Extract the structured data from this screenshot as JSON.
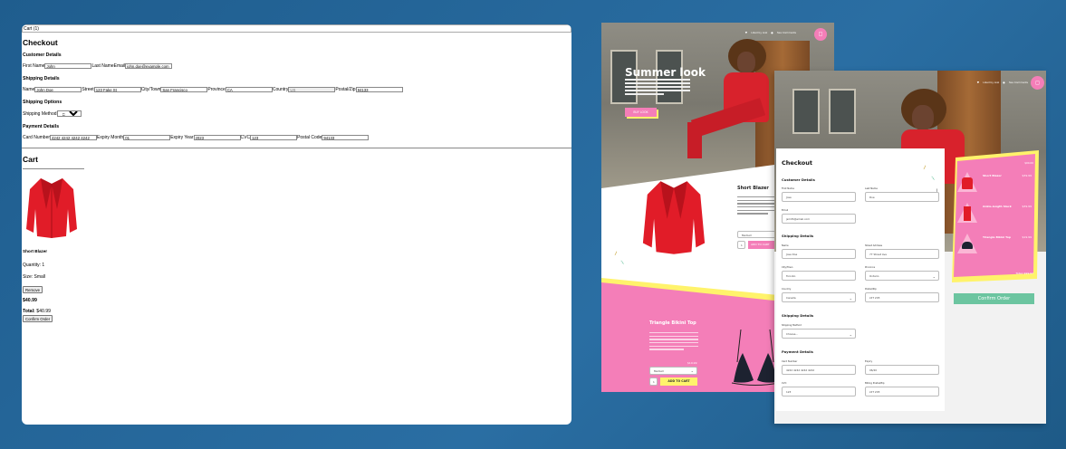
{
  "left_panel": {
    "cart_tab": "Cart (1)",
    "checkout_title": "Checkout",
    "customer_heading": "Customer Details",
    "first_name_label": "First Name",
    "first_name_value": "John",
    "last_name_label": "Last Name",
    "email_label": "Email",
    "email_value": "john.doe@example.com",
    "shipping_heading": "Shipping Details",
    "name_label": "Name",
    "name_value": "John Doe",
    "street_label": "Street",
    "street_value": "123 Fake St",
    "city_label": "City/Town",
    "city_value": "San Francisco",
    "province_label": "Province",
    "province_value": "CA",
    "country_label": "Country",
    "country_value": "US",
    "postal_label": "Postal/Zip",
    "postal_value": "94133",
    "shipping_options_heading": "Shipping Options",
    "shipping_method_label": "Shipping Method",
    "shipping_method_value": "Choose...",
    "payment_heading": "Payment Details",
    "card_label": "Card Number",
    "card_value": "4242 4242 4242 4242",
    "exp_month_label": "Expiry Month",
    "exp_month_value": "01",
    "exp_year_label": "Expiry Year",
    "exp_year_value": "2023",
    "cvc_label": "CVC",
    "cvc_value": "123",
    "postal_code_label": "Postal Code",
    "postal_code_value": "94133",
    "cart_title": "Cart",
    "product_name": "Short Blazer",
    "quantity": "Quantity: 1",
    "size": "Size: Small",
    "remove_button": "Remove",
    "price": "$40.99",
    "total_label": "Total:",
    "total_value": "$40.99",
    "confirm_button": "Confirm Order"
  },
  "mockup_shop": {
    "liked": "Liked by Lisk",
    "comments": "3ea Comments",
    "hero_title": "Summer look",
    "hero_button": "BUY LOOK",
    "product1_name": "Short Blazer",
    "product1_size": "Medium",
    "product1_qty": "1",
    "product1_add": "ADD TO CART",
    "product2_name": "Triangle Bikini Top",
    "product2_price": "$19.99",
    "product2_size": "Medium",
    "product2_qty": "1",
    "product2_add": "ADD TO CART"
  },
  "mockup_checkout": {
    "liked": "Liked by Lisk",
    "comments": "3ea Comments",
    "title": "Checkout",
    "customer_heading": "Customer Details",
    "first_name_label": "First Name",
    "first_name_value": "Jose",
    "last_name_label": "Last Name",
    "last_name_value": "Doe",
    "email_label": "Email",
    "email_value": "jsmith@email.com",
    "shipping_heading": "Shipping Details",
    "name_label": "Name",
    "name_value": "Jose Doe",
    "street_label": "Street Address",
    "street_value": "77 Street Ave",
    "city_label": "City/Town",
    "city_value": "Toronto",
    "province_label": "Province",
    "province_value": "Ontario",
    "country_label": "Country",
    "country_value": "Canada",
    "postal_label": "Postal/Zip",
    "postal_value": "L5T 2X5",
    "shipping_options_heading": "Shipping Details",
    "shipping_method_label": "Shipping Method",
    "shipping_method_value": "Choose...",
    "payment_heading": "Payment Details",
    "card_label": "Card Number",
    "card_value": "4242 4242 4242 4242",
    "expiry_label": "Expiry",
    "expiry_value": "06/20",
    "cvc_label": "CVC",
    "cvc_value": "123",
    "billing_label": "Billing Postal/Zip",
    "billing_value": "L5T 2X5",
    "cart_subtotal": "$00.00",
    "cart_items": [
      {
        "name": "Short Blazer",
        "price": "$39.99"
      },
      {
        "name": "Ankle-length Slack",
        "price": "$39.99"
      },
      {
        "name": "Triangle Bikini Top",
        "price": "$19.99"
      }
    ],
    "cart_total": "Total: $99.97",
    "confirm_button": "Confirm Order"
  },
  "colors": {
    "background": "#266aa0",
    "pink": "#f47eb8",
    "yellow": "#fff36b",
    "green": "#6cc5a0",
    "red": "#e0222c"
  }
}
